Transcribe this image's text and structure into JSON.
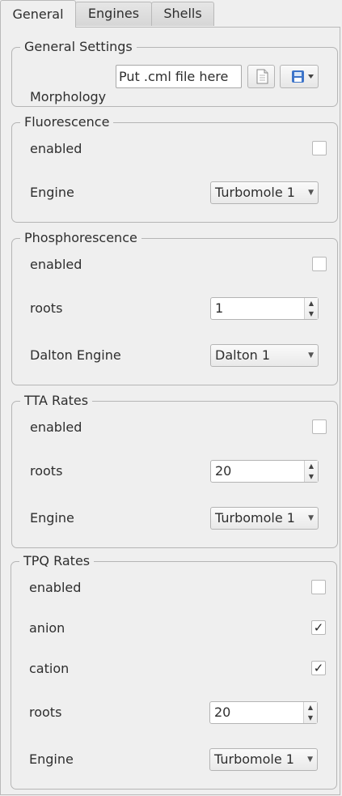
{
  "tabs": [
    {
      "label": "General"
    },
    {
      "label": "Engines"
    },
    {
      "label": "Shells"
    }
  ],
  "general_settings": {
    "title": "General Settings",
    "morphology_label": "Morphology",
    "morphology_value": "Put .cml file here",
    "file_icon": "document-icon",
    "dropdown_icon": "save-dropdown-icon"
  },
  "fluorescence": {
    "title": "Fluorescence",
    "enabled_label": "enabled",
    "enabled": false,
    "engine_label": "Engine",
    "engine_value": "Turbomole 1"
  },
  "phosphorescence": {
    "title": "Phosphorescence",
    "enabled_label": "enabled",
    "enabled": false,
    "roots_label": "roots",
    "roots_value": "1",
    "engine_label": "Dalton Engine",
    "engine_value": "Dalton 1"
  },
  "tta_rates": {
    "title": "TTA Rates",
    "enabled_label": "enabled",
    "enabled": false,
    "roots_label": "roots",
    "roots_value": "20",
    "engine_label": "Engine",
    "engine_value": "Turbomole 1"
  },
  "tpq_rates": {
    "title": "TPQ Rates",
    "enabled_label": "enabled",
    "enabled": false,
    "anion_label": "anion",
    "anion": true,
    "cation_label": "cation",
    "cation": true,
    "roots_label": "roots",
    "roots_value": "20",
    "engine_label": "Engine",
    "engine_value": "Turbomole 1"
  },
  "glyphs": {
    "check": "✓",
    "arrow_down": "▼",
    "arrow_up": "▲"
  }
}
